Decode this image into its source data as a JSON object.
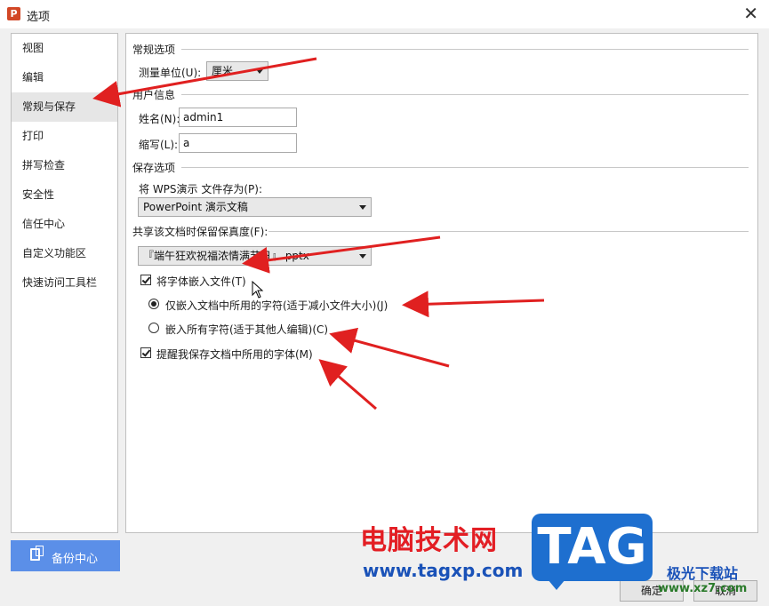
{
  "window": {
    "title": "选项",
    "app_icon_letter": "P"
  },
  "nav": {
    "items": [
      {
        "label": "视图"
      },
      {
        "label": "编辑"
      },
      {
        "label": "常规与保存"
      },
      {
        "label": "打印"
      },
      {
        "label": "拼写检查"
      },
      {
        "label": "安全性"
      },
      {
        "label": "信任中心"
      },
      {
        "label": "自定义功能区"
      },
      {
        "label": "快速访问工具栏"
      }
    ],
    "active": "常规与保存",
    "backup_label": "备份中心"
  },
  "general": {
    "section_title": "常规选项",
    "unit_label": "测量单位(U):",
    "unit_value": "厘米"
  },
  "user": {
    "section_title": "用户信息",
    "name_label": "姓名(N):",
    "name_value": "admin1",
    "initials_label": "缩写(L):",
    "initials_value": "a"
  },
  "save": {
    "section_title": "保存选项",
    "format_label": "将 WPS演示 文件存为(P):",
    "format_value": "PowerPoint 演示文稿"
  },
  "fidelity": {
    "section_title": "共享该文档时保留保真度(F):",
    "document_value": "『端午狂欢祝福浓情满节日』.pptx",
    "embed_fonts_label": "将字体嵌入文件(T)",
    "embed_fonts_checked": true,
    "embed_used_label": "仅嵌入文档中所用的字符(适于减小文件大小)(J)",
    "embed_used_checked": true,
    "embed_all_label": "嵌入所有字符(适于其他人编辑)(C)",
    "embed_all_checked": false,
    "remind_label": "提醒我保存文档中所用的字体(M)",
    "remind_checked": true
  },
  "buttons": {
    "ok": "确定",
    "cancel": "取消"
  },
  "watermark": {
    "site_cn": "电脑技术网",
    "site_url": "www.tagxp.com",
    "tag": "TAG",
    "xz_cn": "极光下载站",
    "xz_url": "www.xz7.com"
  },
  "colors": {
    "accent": "#5b8fe8",
    "arrow": "#e02020",
    "app_icon": "#d24726"
  }
}
